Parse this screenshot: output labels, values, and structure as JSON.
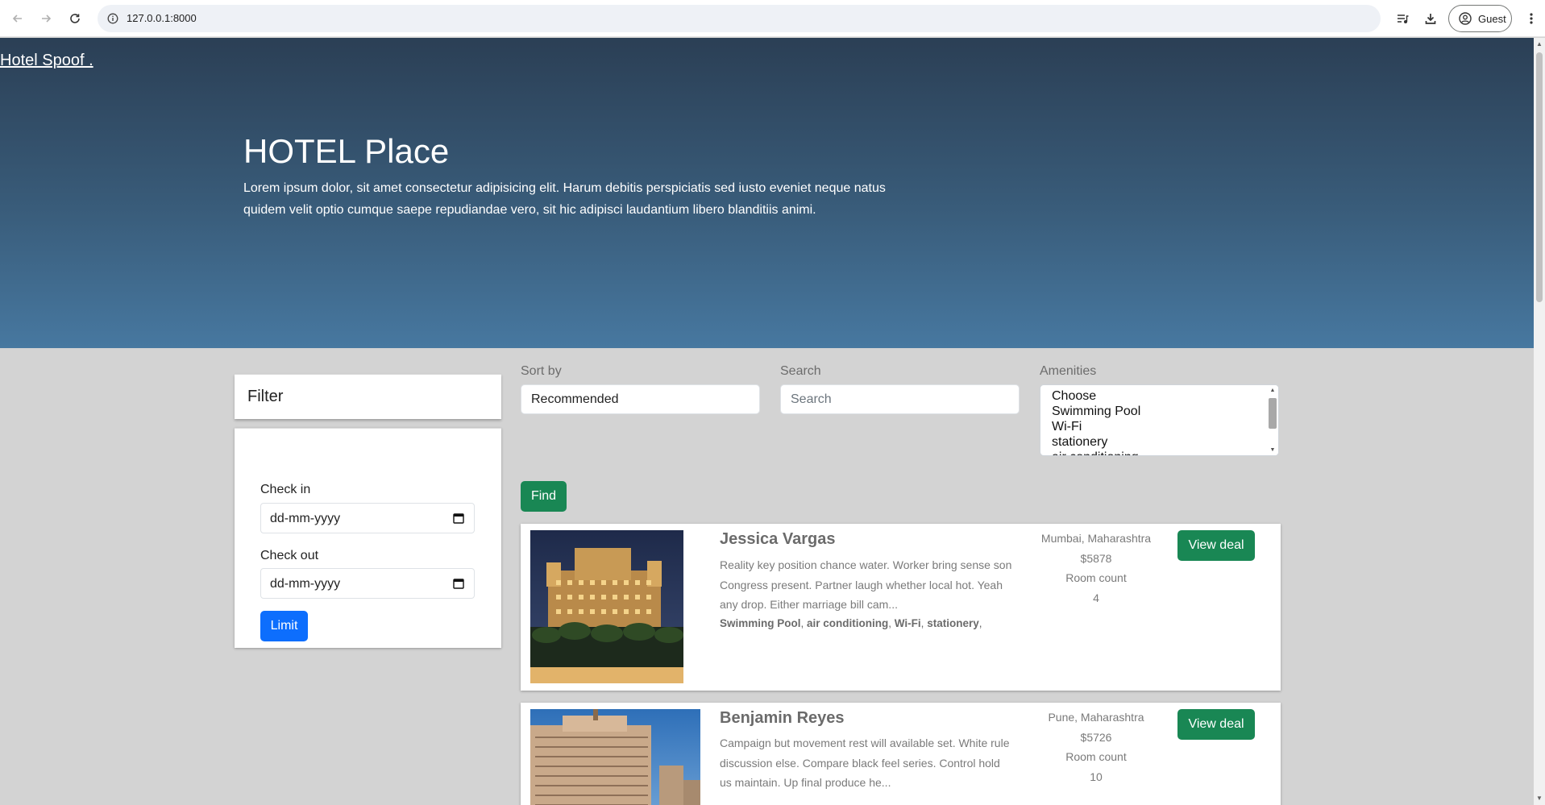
{
  "browser": {
    "url": "127.0.0.1:8000",
    "profile_label": "Guest",
    "icons": [
      "back-arrow-icon",
      "forward-arrow-icon",
      "reload-icon",
      "site-info-icon",
      "media-controls-icon",
      "download-icon",
      "profile-icon",
      "kebab-menu-icon"
    ]
  },
  "hero": {
    "brand": "Hotel Spoof .",
    "title": "HOTEL Place",
    "text": "Lorem ipsum dolor, sit amet consectetur adipisicing elit. Harum debitis perspiciatis sed iusto eveniet neque natus quidem velit optio cumque saepe repudiandae vero, sit hic adipisci laudantium libero blanditiis animi."
  },
  "filter": {
    "title": "Filter",
    "checkin_label": "Check in",
    "checkin_value": "dd-mm-yyyy",
    "checkout_label": "Check out",
    "checkout_value": "dd-mm-yyyy",
    "limit_label": "Limit"
  },
  "controls": {
    "sort_label": "Sort by",
    "sort_value": "Recommended",
    "search_label": "Search",
    "search_placeholder": "Search",
    "amenities_label": "Amenities",
    "amenities_options": [
      "Choose",
      "Swimming Pool",
      "Wi-Fi",
      "stationery",
      "air conditioning"
    ],
    "find_label": "Find"
  },
  "results": [
    {
      "name": "Jessica Vargas",
      "description": "Reality key position chance water. Worker bring sense son Congress present. Partner laugh whether local hot. Yeah any drop. Either marriage bill cam...",
      "amenities": [
        "Swimming Pool",
        "air conditioning",
        "Wi-Fi",
        "stationery"
      ],
      "location": "Mumbai, Maharashtra",
      "price": "$5878",
      "room_count_label": "Room count",
      "room_count": "4",
      "cta": "View deal"
    },
    {
      "name": "Benjamin Reyes",
      "description": "Campaign but movement rest will available set. White rule discussion else. Compare black feel series. Control hold us maintain. Up final produce he...",
      "location": "Pune, Maharashtra",
      "price": "$5726",
      "room_count_label": "Room count",
      "room_count": "10",
      "cta": "View deal"
    }
  ],
  "colors": {
    "hero_top": "#2b3f55",
    "hero_bottom": "#4778a0",
    "page_bg": "#d3d3d3",
    "primary_blue": "#0d6efd",
    "success_green": "#198754"
  }
}
